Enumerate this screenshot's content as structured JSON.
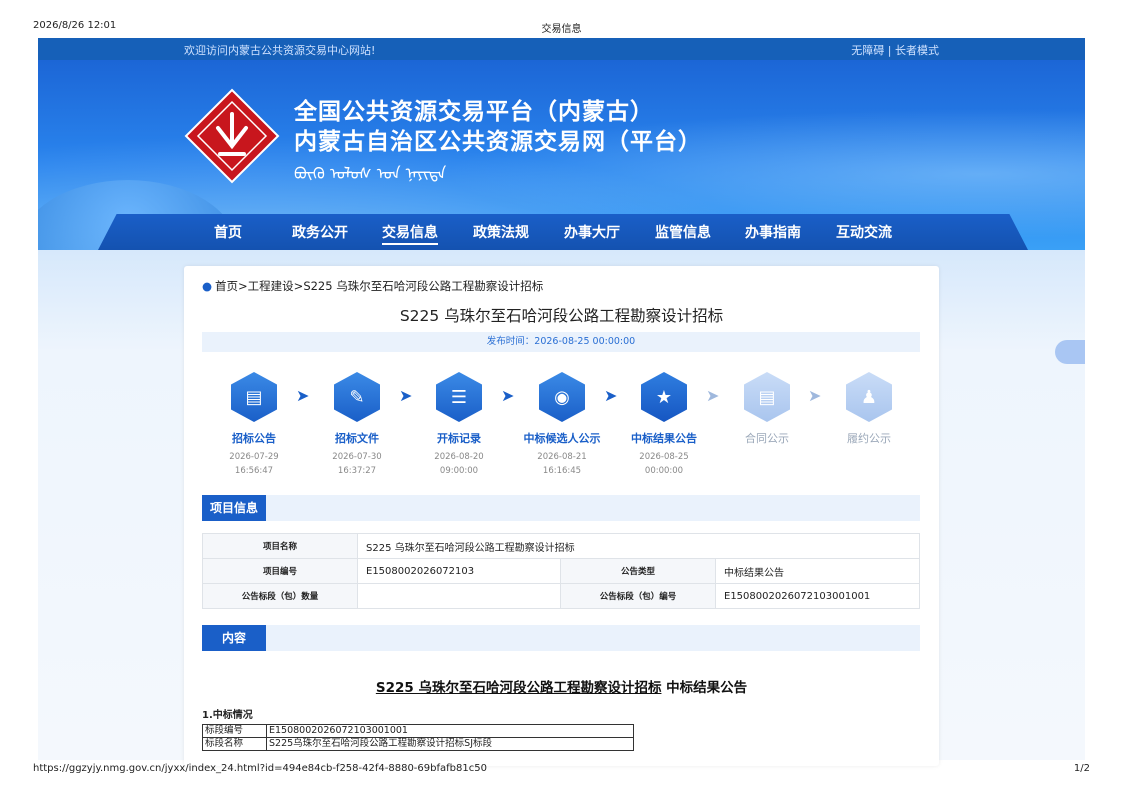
{
  "print": {
    "datetime": "2026/8/26 12:01",
    "tab_title": "交易信息",
    "url": "https://ggzyjy.nmg.gov.cn/jyxx/index_24.html?id=494e84cb-f258-42f4-8880-69bfafb81c50",
    "page": "1/2"
  },
  "topbar": {
    "welcome": "欢迎访问内蒙古公共资源交易中心网站!",
    "accessibility": "无障碍 | 长者模式"
  },
  "banner": {
    "title_line1": "全国公共资源交易平台（内蒙古）",
    "title_line2": "内蒙古自治区公共资源交易网（平台）",
    "mongolian": "ᠪᠦᠬᠦ ᠤᠯᠤᠰ ᠤᠨ ᠨᠡᠶᠢᠲᠡ"
  },
  "nav": {
    "items": [
      "首页",
      "政务公开",
      "交易信息",
      "政策法规",
      "办事大厅",
      "监管信息",
      "办事指南",
      "互动交流"
    ],
    "active": "交易信息"
  },
  "breadcrumb": "首页>工程建设>S225 乌珠尔至石哈河段公路工程勘察设计招标",
  "page_title": "S225 乌珠尔至石哈河段公路工程勘察设计招标",
  "publish_time": "发布时间：2026-08-25 00:00:00",
  "steps": [
    {
      "label": "招标公告",
      "date": "2026-07-29",
      "time": "16:56:47",
      "icon": "document-icon",
      "state": "done"
    },
    {
      "label": "招标文件",
      "date": "2026-07-30",
      "time": "16:37:27",
      "icon": "edit-document-icon",
      "state": "done"
    },
    {
      "label": "开标记录",
      "date": "2026-08-20",
      "time": "09:00:00",
      "icon": "record-icon",
      "state": "done"
    },
    {
      "label": "中标候选人公示",
      "date": "2026-08-21",
      "time": "16:16:45",
      "icon": "target-icon",
      "state": "done"
    },
    {
      "label": "中标结果公告",
      "date": "2026-08-25",
      "time": "00:00:00",
      "icon": "award-icon",
      "state": "current"
    },
    {
      "label": "合同公示",
      "date": "",
      "time": "",
      "icon": "contract-icon",
      "state": "pending"
    },
    {
      "label": "履约公示",
      "date": "",
      "time": "",
      "icon": "people-icon",
      "state": "pending"
    }
  ],
  "project_info": {
    "section_label": "项目信息",
    "name_key": "项目名称",
    "name_val": "S225 乌珠尔至石哈河段公路工程勘察设计招标",
    "code_key": "项目编号",
    "code_val": "E1508002026072103",
    "type_key": "公告类型",
    "type_val": "中标结果公告",
    "count_key": "公告标段（包）数量",
    "count_val": "",
    "seg_key": "公告标段（包）编号",
    "seg_val": "E1508002026072103001001"
  },
  "content": {
    "section_label": "内容",
    "title_underlined": "S225 乌珠尔至石哈河段公路工程勘察设计招标",
    "title_rest": " 中标结果公告",
    "heading1": "1.中标情况",
    "rows": [
      {
        "k": "标段编号",
        "v": "E1508002026072103001001"
      },
      {
        "k": "标段名称",
        "v": "S225乌珠尔至石哈河段公路工程勘察设计招标SJ标段"
      }
    ]
  },
  "colors": {
    "brand": "#1a5fc8",
    "topbar": "#1660b8",
    "light_bg": "#eaf2fc"
  }
}
